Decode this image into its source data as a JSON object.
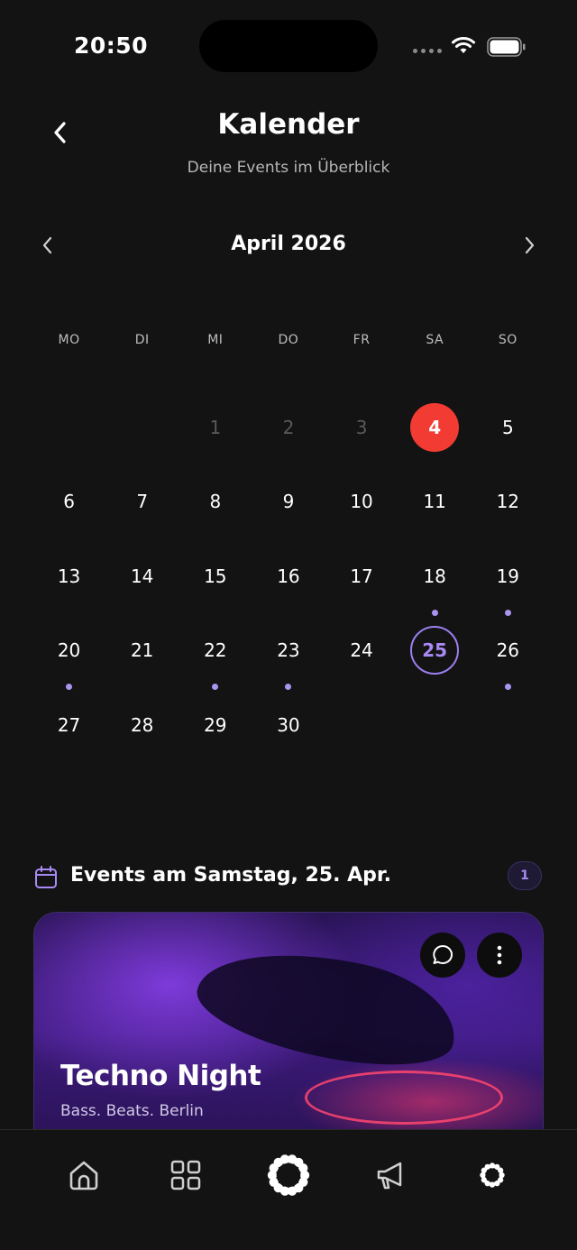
{
  "status_bar": {
    "time": "20:50"
  },
  "header": {
    "title": "Kalender",
    "subtitle": "Deine Events im Überblick"
  },
  "month_nav": {
    "label": "April 2026"
  },
  "weekdays": [
    "MO",
    "DI",
    "MI",
    "DO",
    "FR",
    "SA",
    "SO"
  ],
  "calendar": {
    "leading_blanks": 2,
    "days": [
      {
        "n": "1",
        "muted": true
      },
      {
        "n": "2",
        "muted": true
      },
      {
        "n": "3",
        "muted": true
      },
      {
        "n": "4",
        "today": true
      },
      {
        "n": "5"
      },
      {
        "n": "6"
      },
      {
        "n": "7"
      },
      {
        "n": "8"
      },
      {
        "n": "9"
      },
      {
        "n": "10"
      },
      {
        "n": "11"
      },
      {
        "n": "12"
      },
      {
        "n": "13"
      },
      {
        "n": "14"
      },
      {
        "n": "15"
      },
      {
        "n": "16"
      },
      {
        "n": "17"
      },
      {
        "n": "18",
        "dot": true
      },
      {
        "n": "19",
        "dot": true
      },
      {
        "n": "20",
        "dot": true
      },
      {
        "n": "21"
      },
      {
        "n": "22",
        "dot": true
      },
      {
        "n": "23",
        "dot": true
      },
      {
        "n": "24"
      },
      {
        "n": "25",
        "selected": true
      },
      {
        "n": "26",
        "dot": true
      },
      {
        "n": "27"
      },
      {
        "n": "28"
      },
      {
        "n": "29"
      },
      {
        "n": "30"
      }
    ]
  },
  "events_section": {
    "title": "Events am Samstag, 25. Apr.",
    "count": "1"
  },
  "event_card": {
    "title": "Techno Night",
    "subtitle": "Bass. Beats. Berlin"
  },
  "bottom_nav": {
    "items": [
      "home-icon",
      "grid-icon",
      "logo-icon",
      "megaphone-icon",
      "ring-icon"
    ]
  },
  "colors": {
    "background": "#131313",
    "today": "#f23b32",
    "accent": "#a88af5"
  }
}
